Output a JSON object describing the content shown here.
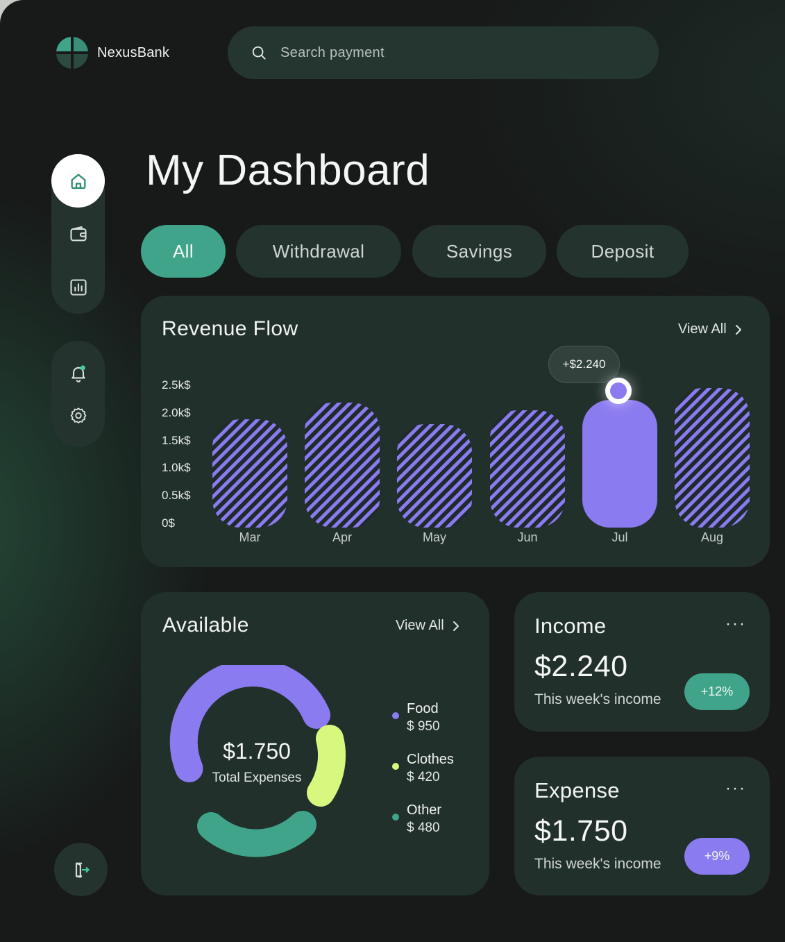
{
  "brand": {
    "name": "NexusBank"
  },
  "search": {
    "placeholder": "Search payment"
  },
  "sidebar": {
    "items": [
      {
        "icon": "home-icon",
        "active": true
      },
      {
        "icon": "wallet-icon"
      },
      {
        "icon": "bar-chart-icon"
      },
      {
        "icon": "bell-icon",
        "notification": true
      },
      {
        "icon": "settings-icon"
      }
    ],
    "logout_icon": "logout-icon"
  },
  "page": {
    "title": "My Dashboard"
  },
  "tabs": [
    {
      "label": "All",
      "active": true
    },
    {
      "label": "Withdrawal"
    },
    {
      "label": "Savings"
    },
    {
      "label": "Deposit"
    }
  ],
  "revenue": {
    "title": "Revenue Flow",
    "view_all": "View All",
    "tooltip": "+$2.240",
    "y_ticks": [
      "2.5k$",
      "2.0k$",
      "1.5k$",
      "1.0k$",
      "0.5k$",
      "0$"
    ]
  },
  "available": {
    "title": "Available",
    "view_all": "View All",
    "total_value": "$1.750",
    "total_label": "Total Expenses",
    "legend": [
      {
        "name": "Food",
        "value": "$ 950",
        "color": "#8b7bf0"
      },
      {
        "name": "Clothes",
        "value": "$ 420",
        "color": "#d8f77e"
      },
      {
        "name": "Other",
        "value": "$ 480",
        "color": "#3fa48a"
      }
    ]
  },
  "income": {
    "title": "Income",
    "amount": "$2.240",
    "sub": "This week's income",
    "badge": "+12%",
    "badge_color": "#3fa48a",
    "more": "···"
  },
  "expense": {
    "title": "Expense",
    "amount": "$1.750",
    "sub": "This week's income",
    "badge": "+9%",
    "badge_color": "#8b7bf0",
    "more": "···"
  },
  "colors": {
    "accent_green": "#3fa48a",
    "accent_purple": "#8b7bf0",
    "accent_lime": "#d8f77e"
  },
  "chart_data": {
    "type": "bar",
    "title": "Revenue Flow",
    "categories": [
      "Mar",
      "Apr",
      "May",
      "Jun",
      "Jul",
      "Aug"
    ],
    "values": [
      1900,
      2200,
      1820,
      2060,
      2240,
      2450
    ],
    "highlighted": "Jul",
    "ylim": [
      0,
      2500
    ],
    "ylabel": "",
    "xlabel": ""
  }
}
